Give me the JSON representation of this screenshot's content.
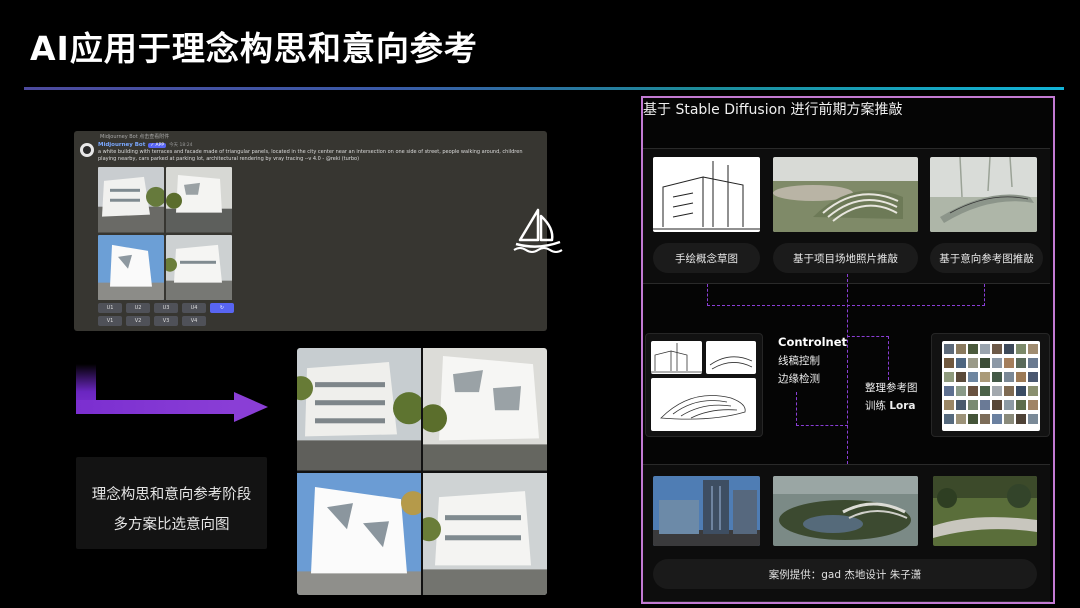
{
  "slide": {
    "title": "AI应用于理念构思和意向参考"
  },
  "midjourney": {
    "top_line": "Midjourney Bot  点击查看附件",
    "bot_name": "Midjourney Bot",
    "badge": "✓ APP",
    "time": "今天 18:24",
    "prompt": "a white building with terraces and facade made of triangular panels, located in the city center near an intersection on one side of street, people walking around, children playing nearby, cars parked at parking lot, architectural rendering by vray tracing --v 4.0 - @reki (turbo)",
    "buttons_row1": [
      "U1",
      "U2",
      "U3",
      "U4",
      "↻"
    ],
    "buttons_row2": [
      "V1",
      "V2",
      "V3",
      "V4",
      ""
    ]
  },
  "stage": {
    "line1": "理念构思和意向参考阶段",
    "line2": "多方案比选意向图"
  },
  "sd": {
    "title": "基于 Stable Diffusion 进行前期方案推敲",
    "pills": [
      "手绘概念草图",
      "基于项目场地照片推敲",
      "基于意向参考图推敲"
    ],
    "controlnet": {
      "title": "Controlnet",
      "items": [
        "线稿控制",
        "边缘检测"
      ]
    },
    "lora": {
      "line1": "整理参考图",
      "line2_prefix": "训练 ",
      "line2_bold": "Lora"
    },
    "credit": "案例提供：gad 杰地设计 朱子潇"
  },
  "colors": {
    "frame": "#c27ad3",
    "dash": "#8a3ed6",
    "arrow": "#7b2fd0",
    "discord_blurple": "#5865f2"
  },
  "icons": [
    "midjourney-boat-icon",
    "reroll-icon",
    "flow-arrow-icon"
  ]
}
